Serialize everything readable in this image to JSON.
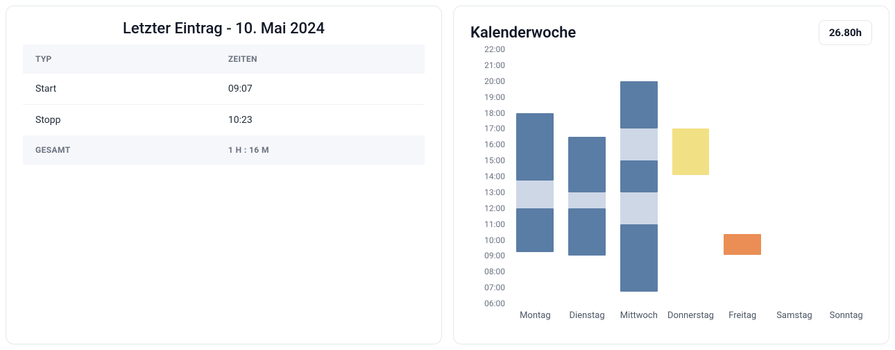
{
  "last_entry": {
    "title": "Letzter Eintrag - 10. Mai 2024",
    "headers": {
      "typ": "TYP",
      "zeiten": "ZEITEN"
    },
    "rows": [
      {
        "typ": "Start",
        "zeit": "09:07"
      },
      {
        "typ": "Stopp",
        "zeit": "10:23"
      }
    ],
    "total": {
      "label": "GESAMT",
      "value": "1 H : 16 M"
    }
  },
  "week": {
    "title": "Kalenderwoche",
    "total": "26.80h"
  },
  "chart_data": {
    "type": "bar",
    "title": "Kalenderwoche",
    "xlabel": "",
    "ylabel": "",
    "ylim": [
      6,
      22
    ],
    "y_ticks": [
      "06:00",
      "07:00",
      "08:00",
      "09:00",
      "10:00",
      "11:00",
      "12:00",
      "13:00",
      "14:00",
      "15:00",
      "16:00",
      "17:00",
      "18:00",
      "19:00",
      "20:00",
      "21:00",
      "22:00"
    ],
    "categories": [
      "Montag",
      "Dienstag",
      "Mittwoch",
      "Donnerstag",
      "Freitag",
      "Samstag",
      "Sonntag"
    ],
    "colors": {
      "work": "#5a7da5",
      "break": "#cdd7e6",
      "yellow": "#f2e084",
      "orange": "#ea8e55"
    },
    "days": [
      {
        "day": "Montag",
        "segments": [
          {
            "from": 9.25,
            "to": 12.0,
            "kind": "work"
          },
          {
            "from": 12.0,
            "to": 13.75,
            "kind": "break"
          },
          {
            "from": 13.75,
            "to": 18.0,
            "kind": "work"
          }
        ]
      },
      {
        "day": "Dienstag",
        "segments": [
          {
            "from": 9.0,
            "to": 12.0,
            "kind": "work"
          },
          {
            "from": 12.0,
            "to": 13.0,
            "kind": "break"
          },
          {
            "from": 13.0,
            "to": 16.5,
            "kind": "work"
          }
        ]
      },
      {
        "day": "Mittwoch",
        "segments": [
          {
            "from": 6.75,
            "to": 11.0,
            "kind": "work"
          },
          {
            "from": 11.0,
            "to": 13.0,
            "kind": "break"
          },
          {
            "from": 13.0,
            "to": 15.0,
            "kind": "work"
          },
          {
            "from": 15.0,
            "to": 17.0,
            "kind": "break"
          },
          {
            "from": 17.0,
            "to": 20.0,
            "kind": "work"
          }
        ]
      },
      {
        "day": "Donnerstag",
        "segments": [
          {
            "from": 14.1,
            "to": 17.0,
            "kind": "yellow"
          }
        ]
      },
      {
        "day": "Freitag",
        "segments": [
          {
            "from": 9.07,
            "to": 10.38,
            "kind": "orange"
          }
        ]
      },
      {
        "day": "Samstag",
        "segments": []
      },
      {
        "day": "Sonntag",
        "segments": []
      }
    ]
  }
}
